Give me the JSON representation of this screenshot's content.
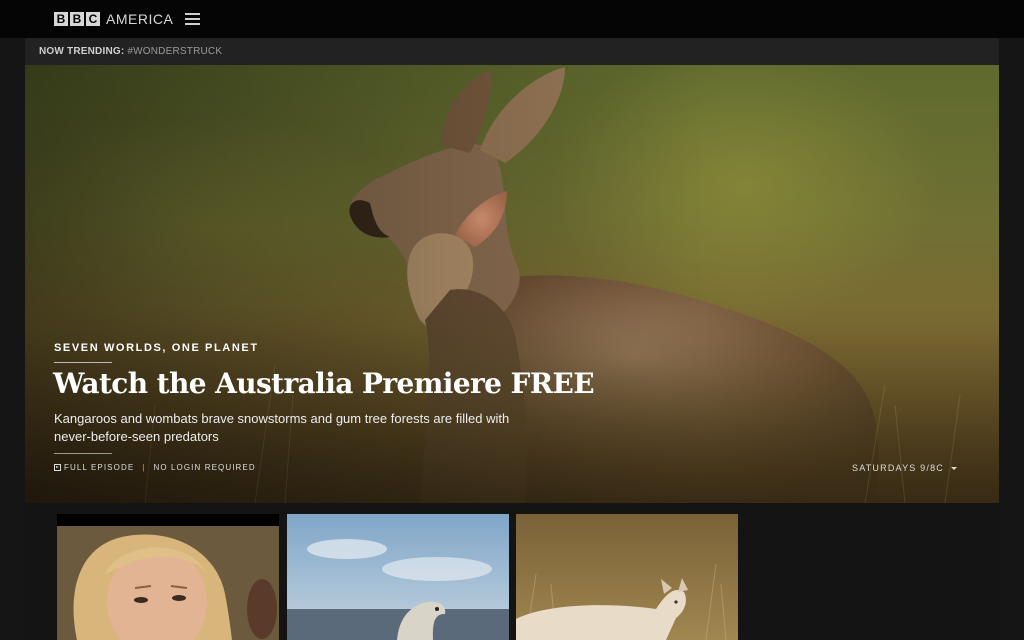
{
  "brand": {
    "letters": [
      "B",
      "B",
      "C"
    ],
    "word": "AMERICA"
  },
  "icons": {
    "menu": "hamburger-menu-icon",
    "episode": "play-square-icon",
    "dropdown": "caret-down-icon"
  },
  "trending": {
    "label": "NOW TRENDING:",
    "tag": "#WONDERSTRUCK"
  },
  "hero": {
    "kicker": "SEVEN WORLDS, ONE PLANET",
    "headline": "Watch the Australia Premiere FREE",
    "description": "Kangaroos and wombats brave snowstorms and gum tree forests are filled with never-before-seen predators",
    "tags": [
      "FULL EPISODE",
      "NO LOGIN REQUIRED"
    ],
    "separator": "|",
    "schedule": "SATURDAYS 9/8C"
  },
  "thumbnails": [
    {
      "subject": "woman-portrait"
    },
    {
      "subject": "polar-bear"
    },
    {
      "subject": "dingo"
    }
  ],
  "colors": {
    "topbar": "#050505",
    "page": "#141414",
    "trending_bar": "#222222"
  }
}
